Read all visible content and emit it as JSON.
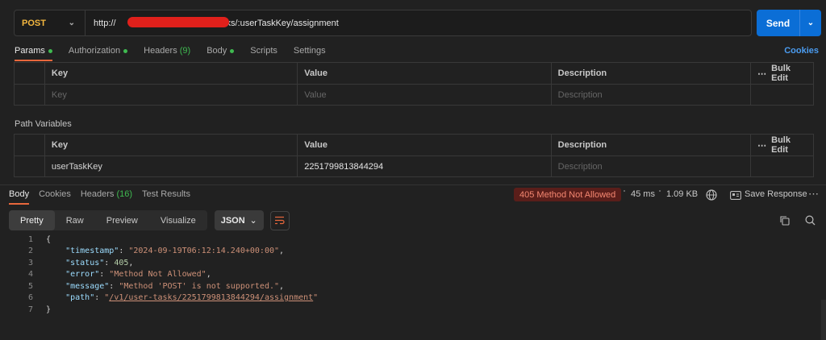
{
  "request": {
    "method": "POST",
    "url": "http://                 :8081/v1/user-tasks/:userTaskKey/assignment",
    "send_label": "Send"
  },
  "request_tabs": [
    {
      "label": "Params",
      "dot": true,
      "active": true
    },
    {
      "label": "Authorization",
      "dot": true
    },
    {
      "label": "Headers",
      "count": "(9)"
    },
    {
      "label": "Body",
      "dot": true
    },
    {
      "label": "Scripts"
    },
    {
      "label": "Settings"
    }
  ],
  "cookies_label": "Cookies",
  "params_table": {
    "headers": {
      "key": "Key",
      "value": "Value",
      "description": "Description",
      "bulk": "Bulk Edit"
    },
    "placeholder": {
      "key": "Key",
      "value": "Value",
      "description": "Description"
    }
  },
  "path_variables": {
    "label": "Path Variables",
    "headers": {
      "key": "Key",
      "value": "Value",
      "description": "Description",
      "bulk": "Bulk Edit"
    },
    "rows": [
      {
        "key": "userTaskKey",
        "value": "2251799813844294",
        "description": "Description"
      }
    ]
  },
  "response_tabs": [
    {
      "label": "Body",
      "active": true
    },
    {
      "label": "Cookies"
    },
    {
      "label": "Headers",
      "count": "(16)"
    },
    {
      "label": "Test Results"
    }
  ],
  "response_meta": {
    "status": "405 Method Not Allowed",
    "time": "45 ms",
    "size": "1.09 KB",
    "save": "Save Response"
  },
  "view_modes": [
    "Pretty",
    "Raw",
    "Preview",
    "Visualize"
  ],
  "format": "JSON",
  "code_lines": {
    "l1": "{",
    "l7": "}",
    "timestamp_key": "\"timestamp\"",
    "timestamp_val": "\"2024-09-19T06:12:14.240+00:00\"",
    "status_key": "\"status\"",
    "status_val": "405",
    "error_key": "\"error\"",
    "error_val": "\"Method Not Allowed\"",
    "message_key": "\"message\"",
    "message_val": "\"Method 'POST' is not supported.\"",
    "path_key": "\"path\"",
    "path_q1": "\"",
    "path_val": "/v1/user-tasks/2251799813844294/assignment",
    "path_q2": "\""
  },
  "line_numbers": [
    "1",
    "2",
    "3",
    "4",
    "5",
    "6",
    "7"
  ],
  "colors": {
    "accent": "#e8673c",
    "send": "#0b6ed6",
    "method": "#f4b73f",
    "error_bg": "#5a1e1a"
  }
}
